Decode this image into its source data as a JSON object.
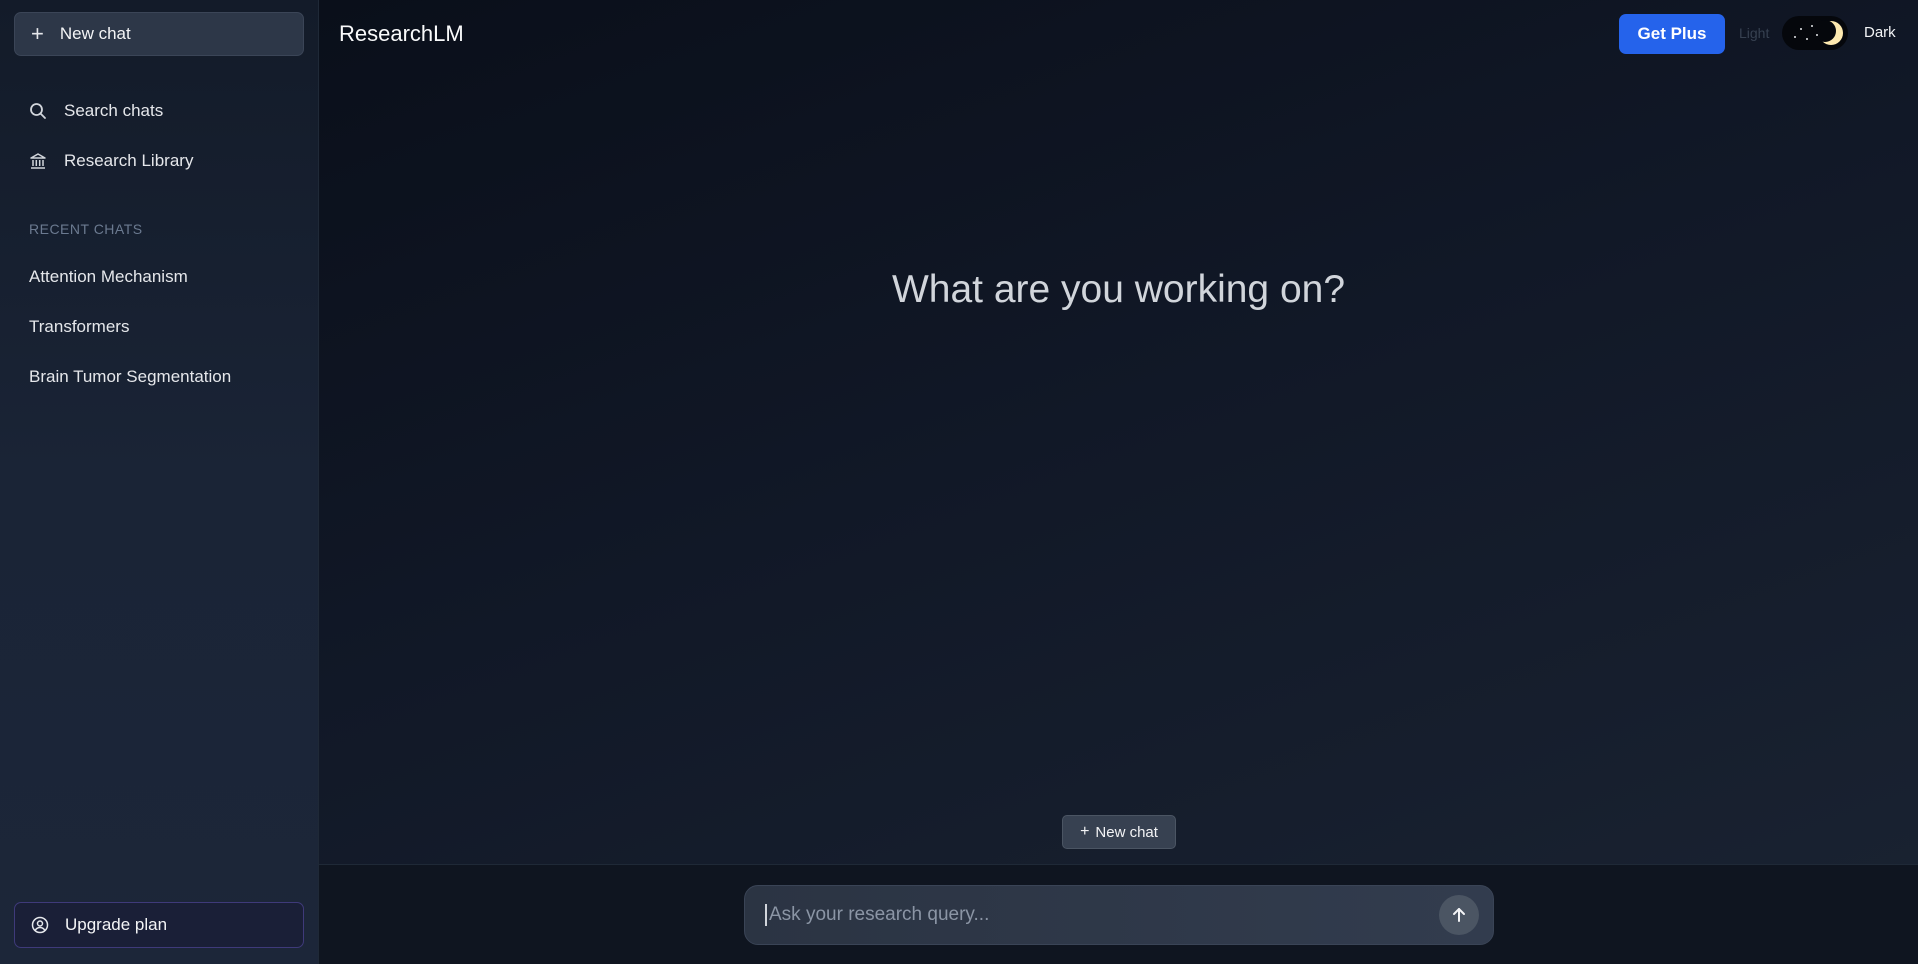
{
  "sidebar": {
    "new_chat_label": "New chat",
    "nav": [
      {
        "label": "Search chats",
        "icon": "search-icon"
      },
      {
        "label": "Research Library",
        "icon": "library-icon"
      }
    ],
    "recent_header": "RECENT CHATS",
    "recent_chats": [
      "Attention Mechanism",
      "Transformers",
      "Brain Tumor Segmentation"
    ],
    "upgrade_label": "Upgrade plan"
  },
  "header": {
    "brand": "ResearchLM",
    "get_plus_label": "Get Plus",
    "theme_light_label": "Light",
    "theme_dark_label": "Dark",
    "theme_mode": "dark"
  },
  "main": {
    "headline": "What are you working on?",
    "new_chat_label": "New chat"
  },
  "composer": {
    "placeholder": "Ask your research query..."
  },
  "colors": {
    "accent": "#2563eb",
    "background": "#0b111c"
  }
}
